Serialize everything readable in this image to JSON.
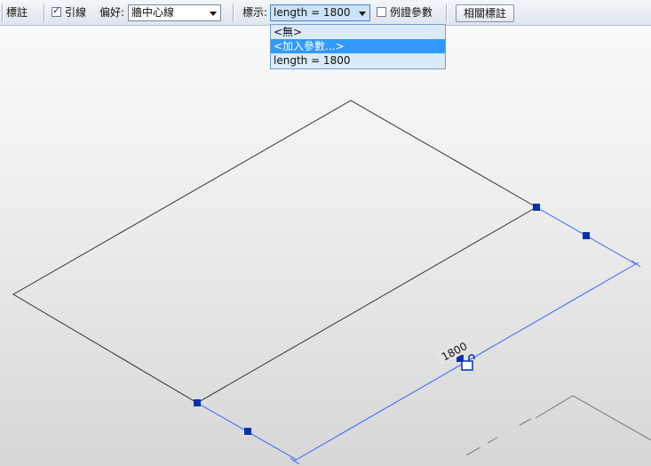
{
  "toolbar": {
    "tag_label": "標註",
    "leader_checkbox": {
      "label": "引線",
      "checked": true
    },
    "prefer_label": "偏好:",
    "prefer_value": "牆中心線",
    "display_label": "標示:",
    "display_value": "length = 1800",
    "instance_param_checkbox": {
      "label": "例證參數",
      "checked": false
    },
    "related_tags_button": "相關標註"
  },
  "dropdown": {
    "options": [
      "<無>",
      "<加入參數...>",
      "length = 1800"
    ],
    "highlighted_index": 1
  },
  "canvas": {
    "dimension_value": "1800"
  },
  "colors": {
    "dimension_line": "#3366ff",
    "grip": "#0033aa",
    "model_line": "#333333",
    "highlight": "#3399ff"
  },
  "icons": {
    "checkbox_check": "✓",
    "lock": "lock-icon"
  }
}
